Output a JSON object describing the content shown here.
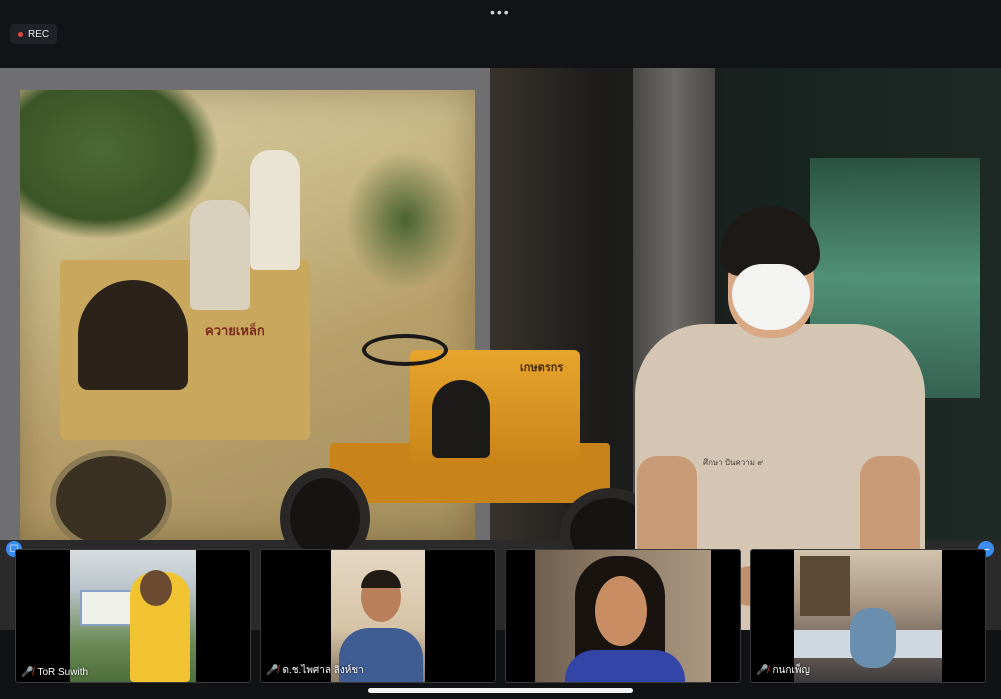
{
  "window": {
    "more_icon": "•••",
    "recording_label": "REC"
  },
  "main_video": {
    "poster_caption": "ควายเหล็ก",
    "tractor_label": "เกษตรกร",
    "shirt_logo": "ศึกษา ปันความ ๙"
  },
  "controls": {
    "edit_icon": "✎",
    "strip_left_icon": "☐",
    "strip_right_icon": "−"
  },
  "participants": [
    {
      "name": "ToR Suwith",
      "mic_muted": true
    },
    {
      "name": "ด.ช.ไพศาล ลิงห์ชา",
      "mic_muted": true
    },
    {
      "name": "",
      "mic_muted": false
    },
    {
      "name": "กนกเพ็ญ",
      "mic_muted": true
    }
  ],
  "colors": {
    "accent": "#3b8df2",
    "recording": "#e0463f",
    "muted": "#e0463f"
  }
}
